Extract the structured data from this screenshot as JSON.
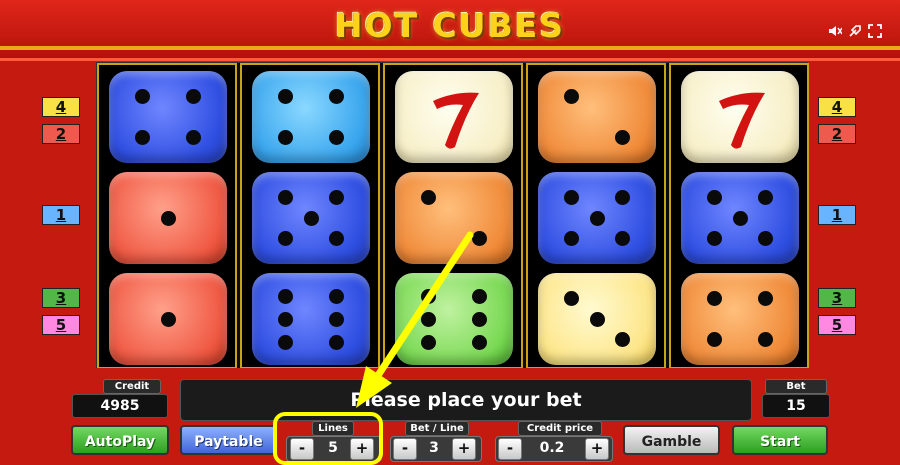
{
  "header": {
    "title": "HOT CUBES",
    "icons": [
      "sound-off-icon",
      "settings-icon",
      "fullscreen-icon"
    ]
  },
  "reels": [
    [
      {
        "color": "blue",
        "pips": 4
      },
      {
        "color": "red",
        "pips": 1
      },
      {
        "color": "red",
        "pips": 1
      }
    ],
    [
      {
        "color": "cyan",
        "pips": 4
      },
      {
        "color": "blue",
        "pips": 5
      },
      {
        "color": "blue",
        "pips": 6
      }
    ],
    [
      {
        "color": "cream",
        "symbol": "seven"
      },
      {
        "color": "orange",
        "pips": 2
      },
      {
        "color": "green",
        "pips": 6
      }
    ],
    [
      {
        "color": "orange",
        "pips": 2
      },
      {
        "color": "blue",
        "pips": 5
      },
      {
        "color": "yellow",
        "pips": 3
      }
    ],
    [
      {
        "color": "cream",
        "symbol": "seven"
      },
      {
        "color": "blue",
        "pips": 5
      },
      {
        "color": "orange",
        "pips": 4
      }
    ]
  ],
  "line_markers": {
    "left": [
      {
        "label": "4",
        "color": "yellow"
      },
      {
        "label": "2",
        "color": "red"
      },
      {
        "label": "1",
        "color": "blue"
      },
      {
        "label": "3",
        "color": "green"
      },
      {
        "label": "5",
        "color": "pink"
      }
    ],
    "right": [
      {
        "label": "4",
        "color": "yellow"
      },
      {
        "label": "2",
        "color": "red"
      },
      {
        "label": "1",
        "color": "blue"
      },
      {
        "label": "3",
        "color": "green"
      },
      {
        "label": "5",
        "color": "pink"
      }
    ]
  },
  "status": {
    "message": "Please place your bet"
  },
  "credit": {
    "label": "Credit",
    "value": "4985"
  },
  "bet": {
    "label": "Bet",
    "value": "15"
  },
  "buttons": {
    "autoplay": "AutoPlay",
    "paytable": "Paytable",
    "gamble": "Gamble",
    "start": "Start"
  },
  "lines": {
    "label": "Lines",
    "value": "5",
    "minus": "-",
    "plus": "+"
  },
  "bet_line": {
    "label": "Bet / Line",
    "value": "3",
    "minus": "-",
    "plus": "+"
  },
  "credit_price": {
    "label": "Credit price",
    "value": "0.2",
    "minus": "-",
    "plus": "+"
  },
  "colors": {
    "background": "#c41a10",
    "accent_gold": "#ffd21a",
    "highlight": "#ffff00"
  }
}
